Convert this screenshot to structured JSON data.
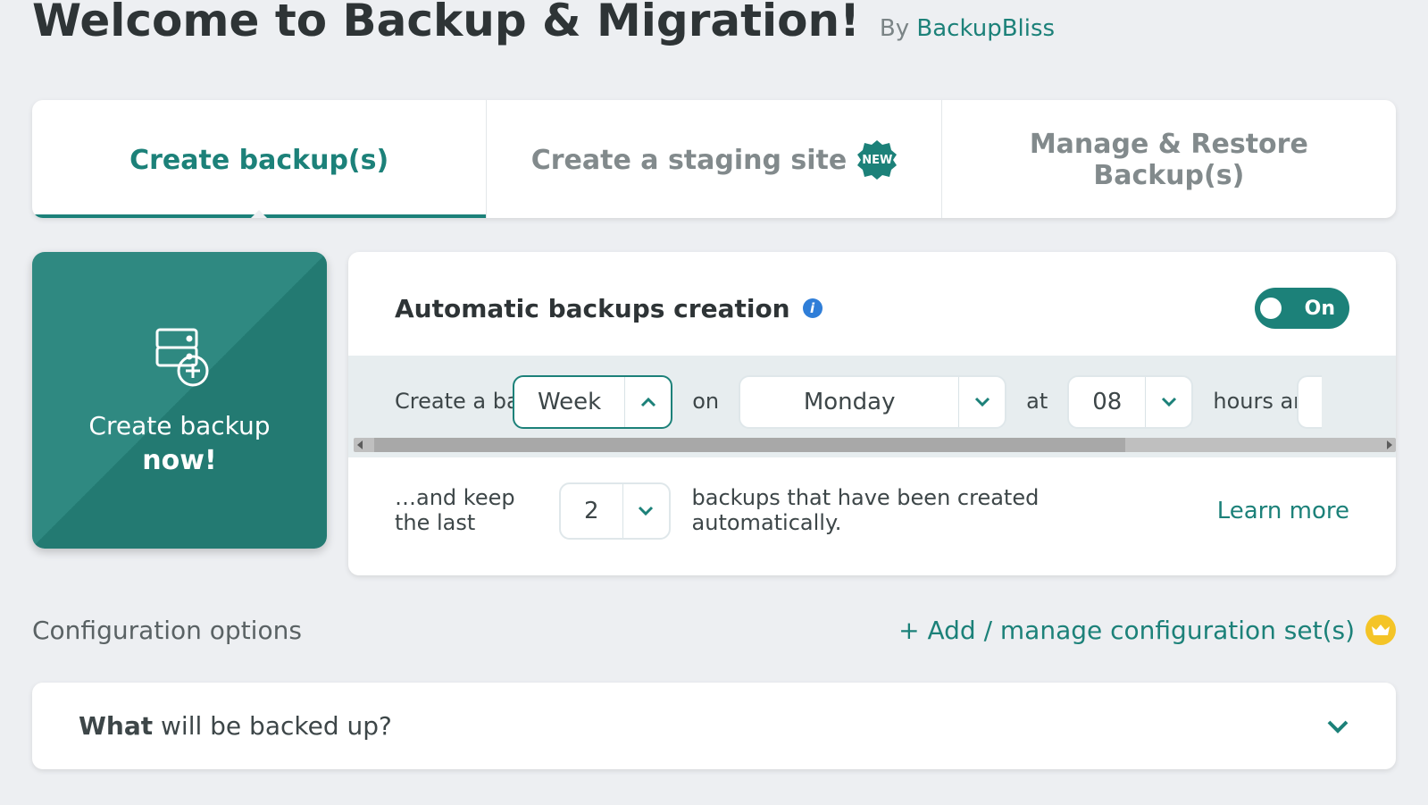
{
  "header": {
    "title": "Welcome to Backup & Migration!",
    "by_prefix": "By",
    "brand": "BackupBliss"
  },
  "tabs": {
    "create": "Create backup(s)",
    "staging": "Create a staging site",
    "staging_badge": "NEW",
    "manage": "Manage & Restore Backup(s)"
  },
  "create_now": {
    "line1": "Create backup",
    "line2": "now!"
  },
  "auto": {
    "title": "Automatic backups creation",
    "toggle": "On",
    "every_label": "Create a backup every",
    "every_value": "Week",
    "on_label": "on",
    "day_value": "Monday",
    "at_label": "at",
    "hour_value": "08",
    "hours_and": "hours and",
    "keep_label": "…and keep the last",
    "keep_value": "2",
    "keep_suffix": "backups that have been created automatically.",
    "learn_more": "Learn more"
  },
  "config": {
    "options": "Configuration options",
    "manage": "+ Add / manage configuration set(s)"
  },
  "accordion": {
    "what_bold": "What",
    "what_rest": " will be backed up?"
  }
}
